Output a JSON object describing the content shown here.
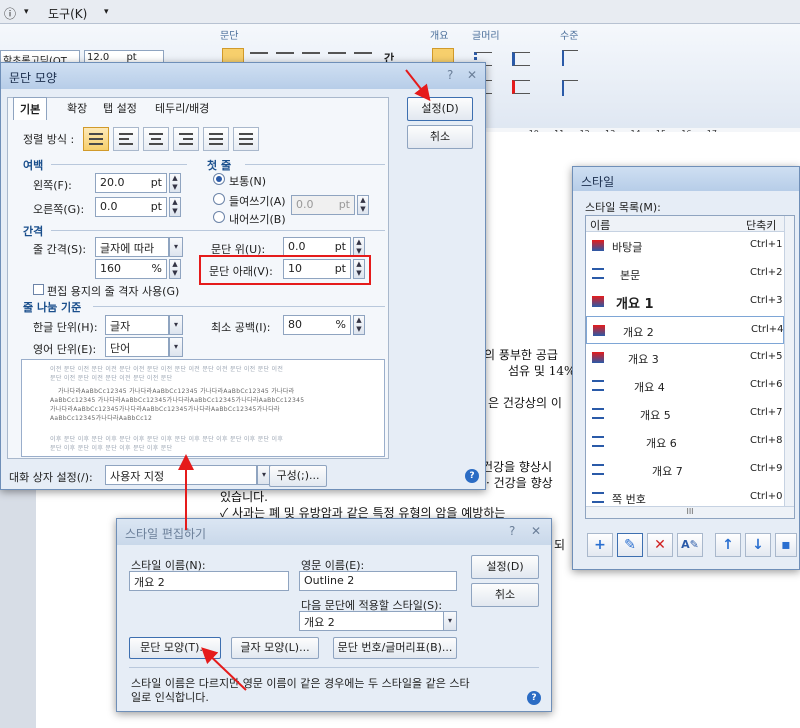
{
  "menu": {
    "item1": "ⓘ",
    "item2": "도구(K)"
  },
  "ribbon": {
    "font_name": "함초롬고딕(OT",
    "font_size": "12.0",
    "font_unit": "pt",
    "groups": {
      "paragraph": "문단",
      "outline": "개요",
      "bullets": "글머리",
      "level": "수준"
    },
    "space_label": "간"
  },
  "ruler": {
    "marks": "...,.10,.....11......12......13......14......15......16......17"
  },
  "document": {
    "lines": [
      "의 풍부한 공급",
      "섬유 및 14%",
      "은 건강상의 이",
      "건강을 향상시",
      "· 건강을 향상",
      "있습니다.",
      "✓  사과는 폐 및 유방암과 같은 특정 유형의 암을 예방하는",
      "되"
    ]
  },
  "para_dialog": {
    "title": "문단 모양",
    "tabs": [
      "기본",
      "확장",
      "탭 설정",
      "테두리/배경"
    ],
    "align_label": "정렬 방식 :",
    "margin_section": "여백",
    "left_label": "왼쪽(F):",
    "left_value": "20.0",
    "left_unit": "pt",
    "right_label": "오른쪽(G):",
    "right_value": "0.0",
    "right_unit": "pt",
    "first_line_section": "첫 줄",
    "radio_normal": "보통(N)",
    "radio_indent": "들여쓰기(A)",
    "radio_outdent": "내어쓰기(B)",
    "indent_value": "0.0",
    "indent_unit": "pt",
    "spacing_section": "간격",
    "line_spacing_label": "줄 간격(S):",
    "line_spacing_type": "글자에 따라",
    "line_spacing_value": "160",
    "line_spacing_unit": "%",
    "before_label": "문단 위(U):",
    "before_value": "0.0",
    "before_unit": "pt",
    "after_label": "문단 아래(V):",
    "after_value": "10",
    "after_unit": "pt",
    "grid_check": "편집 용지의 줄 격자 사용(G)",
    "break_section": "줄 나눔 기준",
    "korean_label": "한글 단위(H):",
    "korean_value": "글자",
    "english_label": "영어 단위(E):",
    "english_value": "단어",
    "min_space_label": "최소 공백(I):",
    "min_space_value": "80",
    "min_space_unit": "%",
    "preview_lines": [
      "이전 문단 이전 문단 이전 문단 이전 문단 이전 문단 이전 문단 이전 문단 이전 문단 이전",
      "문단 이전 문단 이전 문단 이전 문단 이전 문단",
      "가나다라AaBbCc12345   가나다라AaBbCc12345   가나다라AaBbCc12345   가나다라",
      "AaBbCc12345 가나다라AaBbCc12345가나다라AaBbCc12345가나다라AaBbCc12345",
      "가나다라AaBbCc12345가나다라AaBbCc12345가나다라AaBbCc12345가나다라",
      "AaBbCc12345가나다라AaBbCc12",
      "이후 문단 이후 문단 이후 문단 이후 문단 이후 문단 이후 문단 이후 문단 이후 문단 이후",
      "문단 이후 문단 이후 문단 이후 문단 이후 문단"
    ],
    "dialog_setting_label": "대화 상자 설정(/):",
    "dialog_setting_value": "사용자 지정",
    "compose_button": "구성(;)...",
    "ok_button": "설정(D)",
    "cancel_button": "취소",
    "help": "?"
  },
  "style_panel": {
    "title": "스타일",
    "list_label": "스타일 목록(M):",
    "col_name": "이름",
    "col_key": "단축키",
    "items": [
      {
        "name": "바탕글",
        "key": "Ctrl+1"
      },
      {
        "name": "본문",
        "key": "Ctrl+2"
      },
      {
        "name": "개요 1",
        "key": "Ctrl+3"
      },
      {
        "name": "개요 2",
        "key": "Ctrl+4"
      },
      {
        "name": "개요 3",
        "key": "Ctrl+5"
      },
      {
        "name": "개요 4",
        "key": "Ctrl+6"
      },
      {
        "name": "개요 5",
        "key": "Ctrl+7"
      },
      {
        "name": "개요 6",
        "key": "Ctrl+8"
      },
      {
        "name": "개요 7",
        "key": "Ctrl+9"
      },
      {
        "name": "쪽 번호",
        "key": "Ctrl+0"
      }
    ],
    "scroll_mark": "III"
  },
  "edit_dialog": {
    "title": "스타일 편집하기",
    "name_label": "스타일 이름(N):",
    "name_value": "개요 2",
    "eng_label": "영문 이름(E):",
    "eng_value": "Outline 2",
    "next_label": "다음 문단에 적용할 스타일(S):",
    "next_value": "개요 2",
    "ok_button": "설정(D)",
    "cancel_button": "취소",
    "para_button": "문단 모양(T)...",
    "char_button": "글자 모양(L)...",
    "number_button": "문단 번호/글머리표(B)...",
    "note": "스타일 이름은 다르지만 영문 이름이 같은 경우에는 두 스타일을 같은 스타일로 인식합니다.",
    "help": "?"
  },
  "colors": {
    "highlight": "#e51b1b",
    "accent": "#2a5aa8"
  }
}
